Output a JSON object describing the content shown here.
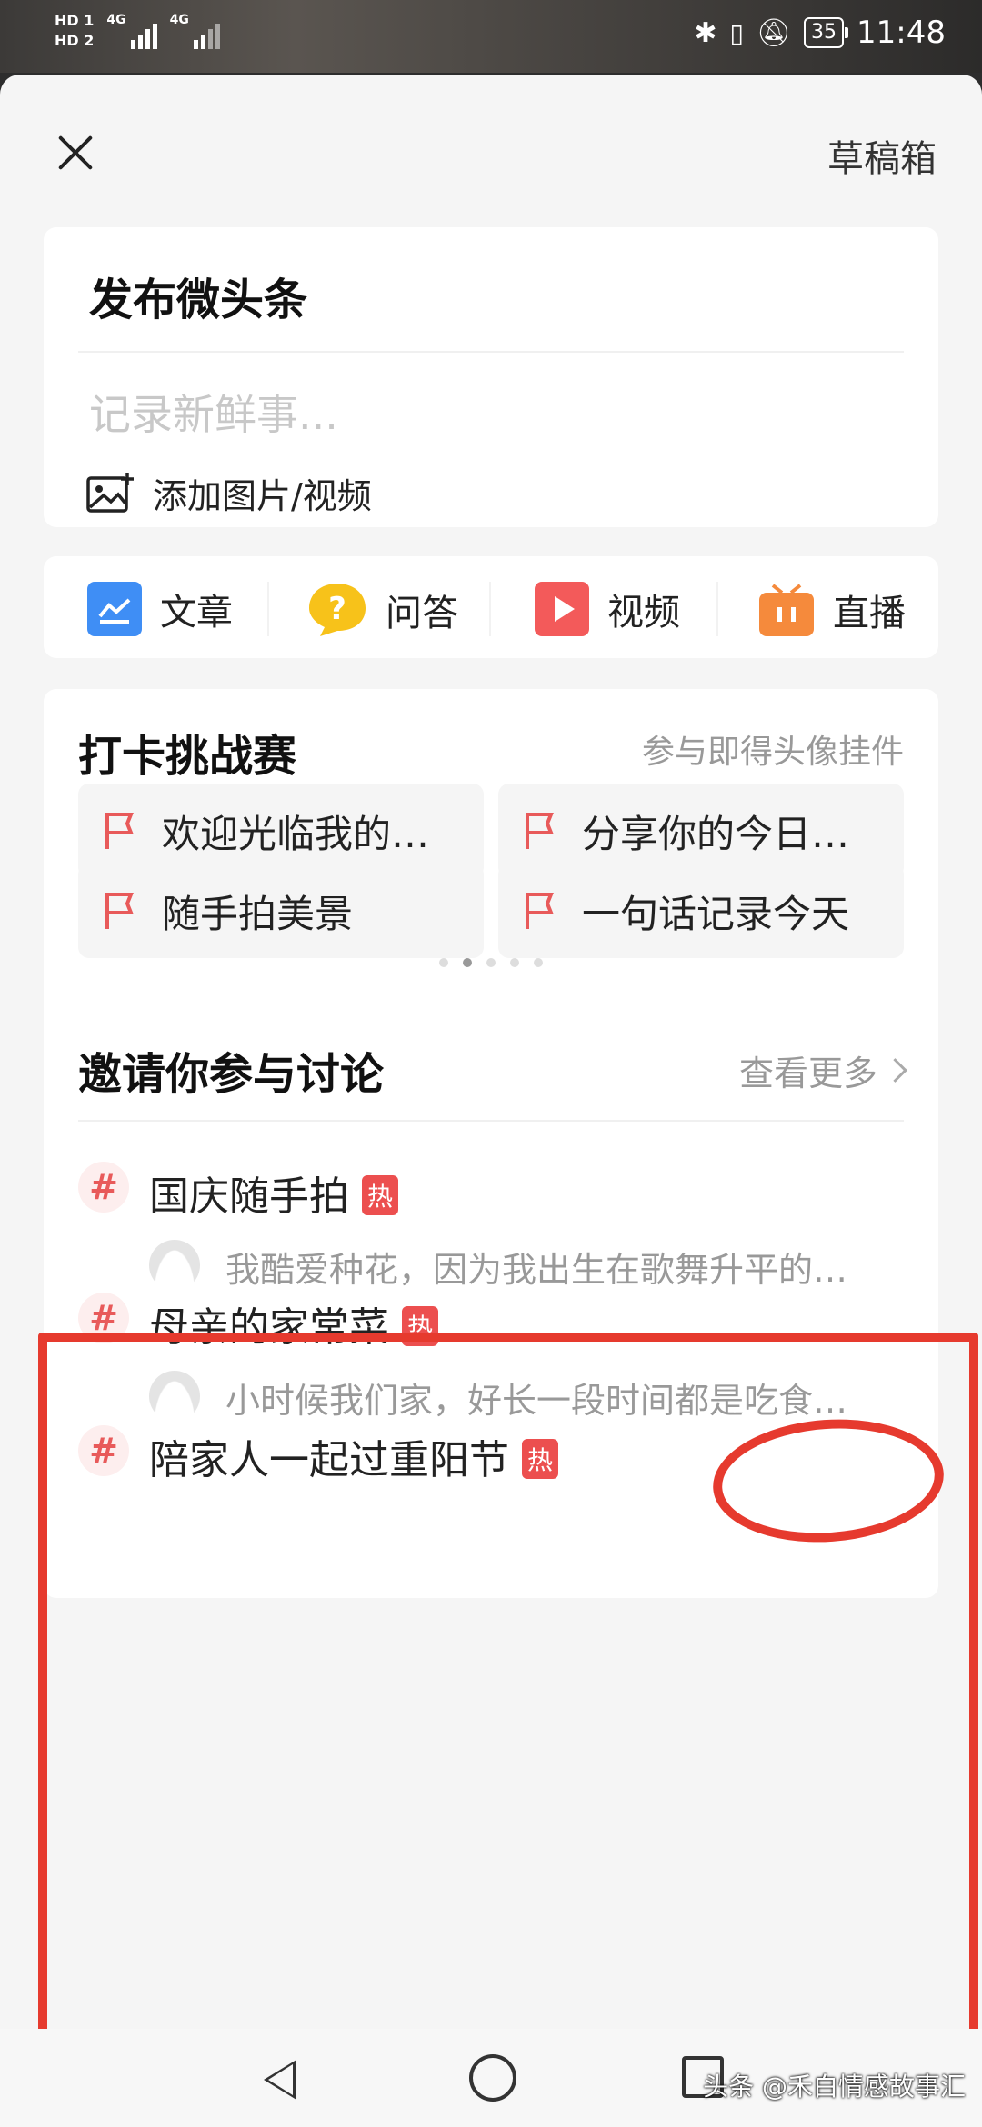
{
  "status_bar": {
    "hd1": "HD 1",
    "hd2": "HD 2",
    "net1": "4G",
    "net2": "4G",
    "battery": "35",
    "time": "11:48"
  },
  "header": {
    "close_icon": "close-icon",
    "drafts_label": "草稿箱"
  },
  "compose": {
    "title": "发布微头条",
    "placeholder": "记录新鲜事...",
    "add_media_label": "添加图片/视频"
  },
  "post_types": [
    {
      "label": "文章",
      "icon": "article-icon",
      "color": "#3f8ef5"
    },
    {
      "label": "问答",
      "icon": "qa-icon",
      "color": "#f7c21a"
    },
    {
      "label": "视频",
      "icon": "video-icon",
      "color": "#f35a5a"
    },
    {
      "label": "直播",
      "icon": "live-icon",
      "color": "#f58a3c"
    }
  ],
  "challenge": {
    "title": "打卡挑战赛",
    "subtitle": "参与即得头像挂件",
    "items": [
      "欢迎光临我的…",
      "分享你的今日…",
      "随手拍美景",
      "一句话记录今天"
    ],
    "page_count": 5,
    "active_page": 1
  },
  "discussion": {
    "title": "邀请你参与讨论",
    "see_more": "查看更多",
    "topics": [
      {
        "title": "国庆随手拍",
        "badge": "热",
        "desc": "我酷爱种花，因为我出生在歌舞升平的…"
      },
      {
        "title": "母亲的家常菜",
        "badge": "热",
        "desc": "小时候我们家，好长一段时间都是吃食…"
      },
      {
        "title": "陪家人一起过重阳节",
        "badge": "热",
        "desc": ""
      }
    ]
  },
  "watermark": "头条 @禾白情感故事汇",
  "accent_color": "#e63a2e"
}
